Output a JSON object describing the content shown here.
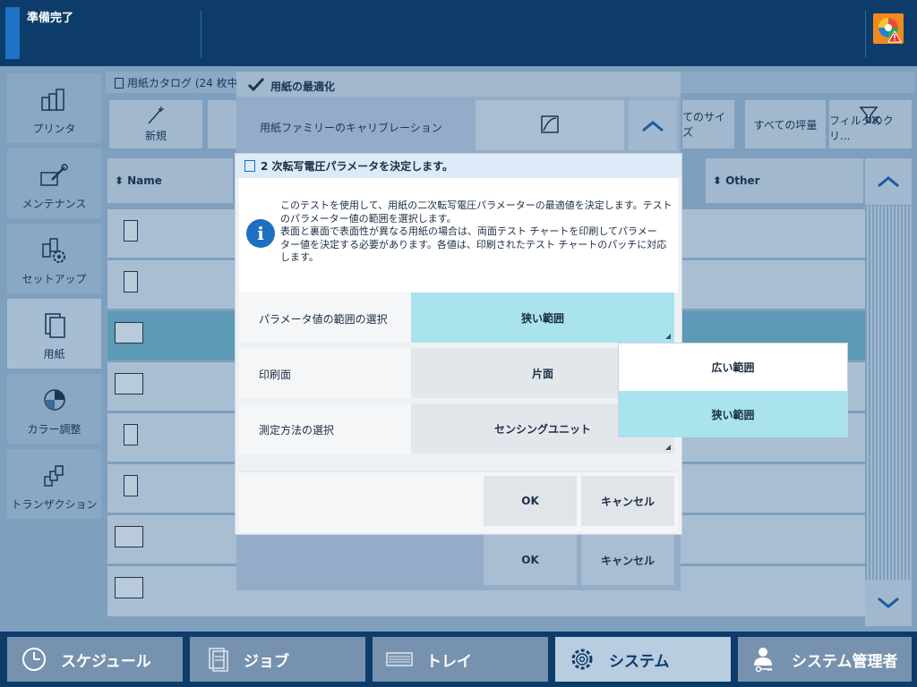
{
  "top": {
    "status": "準備完了"
  },
  "sidebar": {
    "items": [
      {
        "label": "プリンタ"
      },
      {
        "label": "メンテナンス"
      },
      {
        "label": "セットアップ"
      },
      {
        "label": "用紙"
      },
      {
        "label": "カラー調整"
      },
      {
        "label": "トランザクション"
      }
    ]
  },
  "catalog": {
    "title": "用紙カタログ (24 枚中、",
    "toolbar": {
      "new": "新規",
      "all_sizes": "てのサイズ",
      "all_weights": "すべての坪量",
      "filter_clear": "フィルタのクリ..."
    },
    "columns": {
      "name": "Name",
      "other": "Other"
    }
  },
  "parent_dialog": {
    "title": "用紙の最適化",
    "row_label": "用紙ファミリーのキャリブレーション",
    "ok": "OK",
    "cancel": "キャンセル"
  },
  "dialog": {
    "title": "2 次転写電圧パラメータを決定します。",
    "info_lines": [
      "このテストを使用して、用紙の二次転写電圧パラメーターの最適値を決定します。テスト",
      "のパラメーター値の範囲を選択します。",
      "表面と裏面で表面性が異なる用紙の場合は、両面テスト チャートを印刷してパラメー",
      "ター値を決定する必要があります。各値は、印刷されたテスト チャートのパッチに対応",
      "します。"
    ],
    "rows": [
      {
        "label": "パラメータ値の範囲の選択",
        "value": "狭い範囲"
      },
      {
        "label": "印刷面",
        "value": "片面"
      },
      {
        "label": "測定方法の選択",
        "value": "センシングユニット"
      }
    ],
    "ok": "OK",
    "cancel": "キャンセル"
  },
  "dropdown": {
    "options": [
      "広い範囲",
      "狭い範囲"
    ],
    "selected": "狭い範囲"
  },
  "bottom_tabs": [
    {
      "label": "スケジュール"
    },
    {
      "label": "ジョブ"
    },
    {
      "label": "トレイ"
    },
    {
      "label": "システム"
    },
    {
      "label": "システム管理者"
    }
  ],
  "colors": {
    "accent": "#1d6fc1",
    "selected": "#a9e3ee",
    "alert": "#f18a1c"
  }
}
